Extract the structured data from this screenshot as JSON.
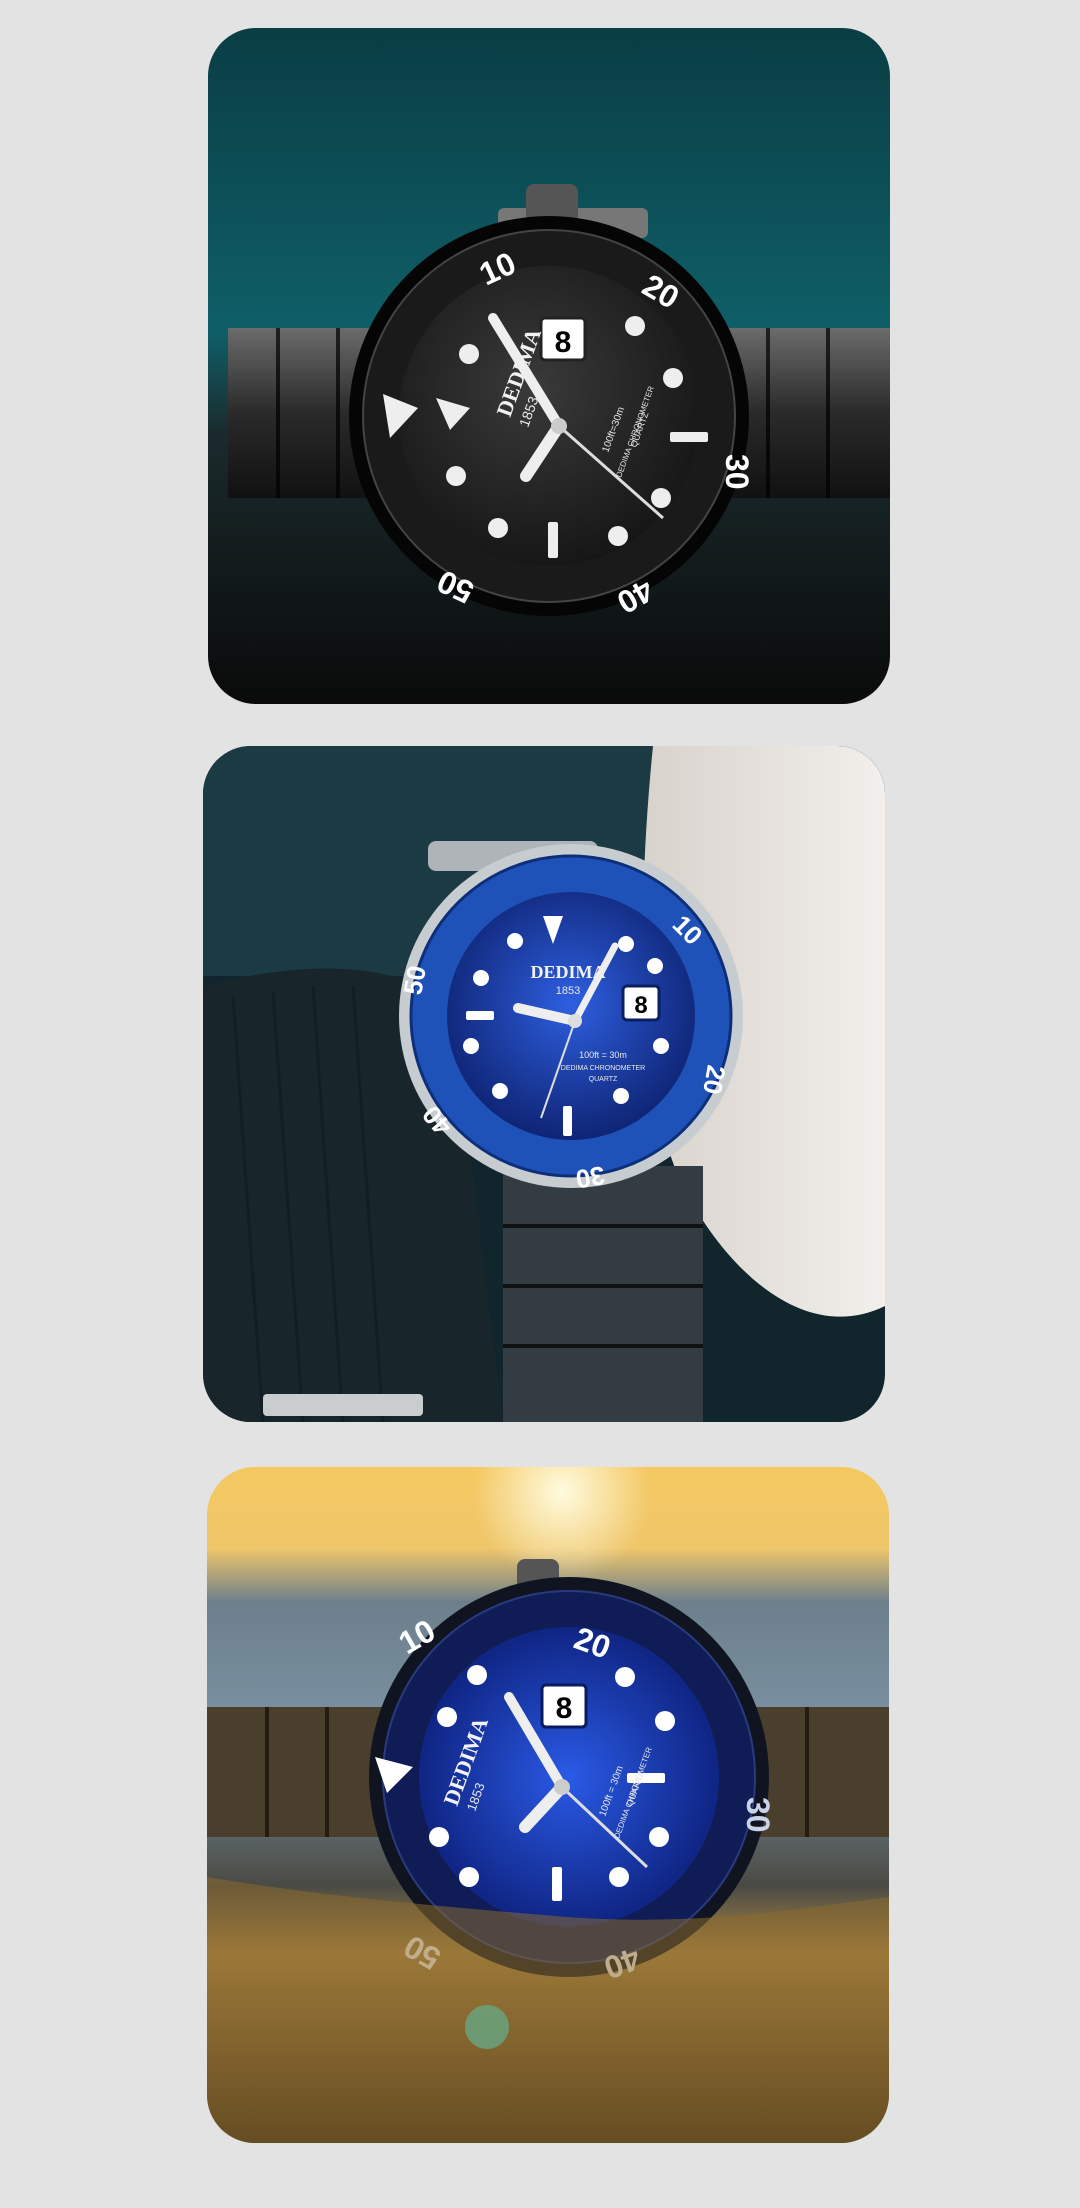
{
  "gallery": {
    "images": [
      {
        "alt": "Black dial dive watch on dark teal background",
        "brand": "DEDIMA",
        "year": "1853",
        "date": "8",
        "line1": "100ft=30m",
        "line2": "DEDIMA CHRONOMETER",
        "line3": "QUARTZ",
        "bezel": [
          "10",
          "20",
          "30",
          "40",
          "50"
        ],
        "colors": {
          "dial": "#1c1c1c",
          "bezel": "#111111",
          "bg": "#0f5a63"
        }
      },
      {
        "alt": "Blue dial dive watch worn on wrist",
        "brand": "DEDIMA",
        "year": "1853",
        "date": "8",
        "line1": "100ft = 30m",
        "line2": "DEDIMA CHRONOMETER",
        "line3": "QUARTZ",
        "bezel": [
          "10",
          "20",
          "30",
          "40",
          "50"
        ],
        "colors": {
          "dial": "#1a3fb0",
          "bezel": "#1f52b8",
          "bg": "#14303c"
        }
      },
      {
        "alt": "Blue dial dive watch on rock at sunset",
        "brand": "DEDIMA",
        "year": "1853",
        "date": "8",
        "line1": "100ft = 30m",
        "line2": "DEDIMA CHRONOMETER",
        "line3": "QUARTZ",
        "bezel": [
          "10",
          "20",
          "30",
          "40",
          "50"
        ],
        "colors": {
          "dial": "#1632a8",
          "bezel": "#0e1a4a",
          "bg": "#e8b84a"
        }
      }
    ]
  }
}
